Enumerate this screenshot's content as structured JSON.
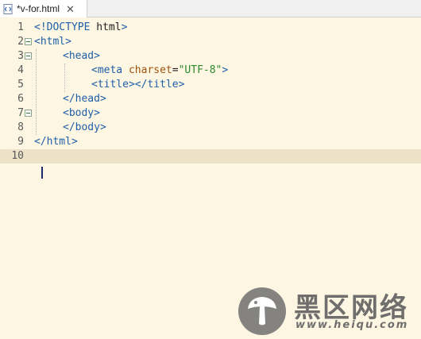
{
  "tab": {
    "label": "*v-for.html",
    "close_glyph": "✕",
    "icon": "html-file-icon"
  },
  "editor": {
    "lines": [
      {
        "number": "1",
        "fold": false,
        "indent": 0,
        "tokens": [
          {
            "t": "tag",
            "v": "<!DOCTYPE "
          },
          {
            "t": "txt",
            "v": "html"
          },
          {
            "t": "tag",
            "v": ">"
          }
        ]
      },
      {
        "number": "2",
        "fold": true,
        "indent": 0,
        "tokens": [
          {
            "t": "tag",
            "v": "<html>"
          }
        ]
      },
      {
        "number": "3",
        "fold": true,
        "indent": 1,
        "tokens": [
          {
            "t": "tag",
            "v": "<head>"
          }
        ]
      },
      {
        "number": "4",
        "fold": false,
        "indent": 2,
        "tokens": [
          {
            "t": "tag",
            "v": "<meta "
          },
          {
            "t": "attr",
            "v": "charset"
          },
          {
            "t": "txt",
            "v": "="
          },
          {
            "t": "val",
            "v": "\"UTF-8\""
          },
          {
            "t": "tag",
            "v": ">"
          }
        ]
      },
      {
        "number": "5",
        "fold": false,
        "indent": 2,
        "tokens": [
          {
            "t": "tag",
            "v": "<title></title>"
          }
        ]
      },
      {
        "number": "6",
        "fold": false,
        "indent": 1,
        "tokens": [
          {
            "t": "tag",
            "v": "</head>"
          }
        ]
      },
      {
        "number": "7",
        "fold": true,
        "indent": 1,
        "tokens": [
          {
            "t": "tag",
            "v": "<body>"
          }
        ]
      },
      {
        "number": "8",
        "fold": false,
        "indent": 1,
        "tokens": [
          {
            "t": "tag",
            "v": "</body>"
          }
        ]
      },
      {
        "number": "9",
        "fold": false,
        "indent": 0,
        "tokens": [
          {
            "t": "tag",
            "v": "</html>"
          }
        ]
      },
      {
        "number": "10",
        "fold": false,
        "indent": 0,
        "current": true,
        "tokens": []
      }
    ]
  },
  "colors": {
    "background": "#fdf6e3",
    "current_line": "#ede2c7",
    "tag": "#1f5fa8",
    "attribute": "#a0520f",
    "value": "#2d8a2d"
  },
  "watermark": {
    "name": "黑区网络",
    "url": "www.heiqu.com",
    "icon": "mushroom-logo-icon"
  }
}
